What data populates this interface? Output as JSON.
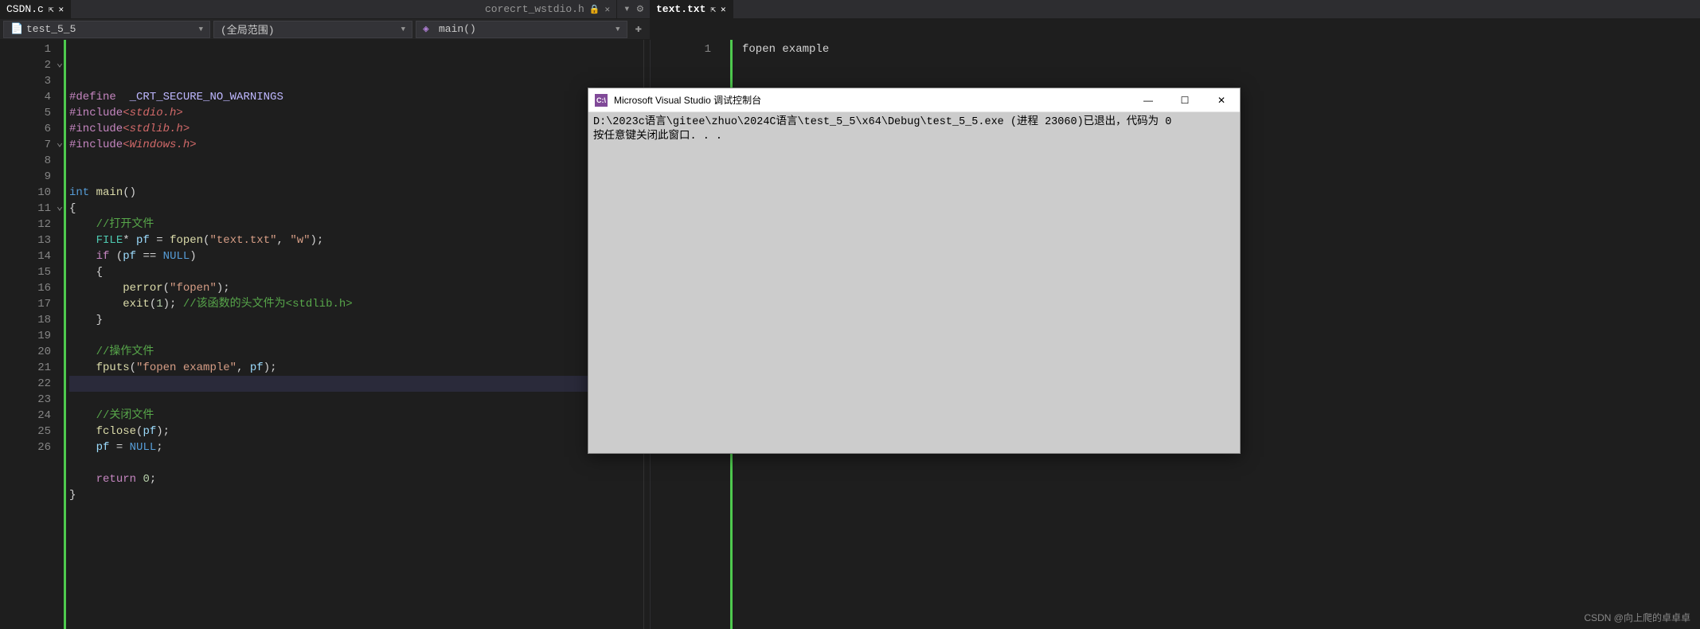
{
  "tabs": {
    "left_active": "CSDN.c",
    "center_inactive": "corecrt_wstdio.h",
    "right_active": "text.txt"
  },
  "context": {
    "file": "test_5_5",
    "scope": "(全局范围)",
    "function": "main()"
  },
  "left_code": {
    "lines": [
      {
        "n": 1,
        "html": "<span class='ppkw'>#define</span>  <span class='mac'>_CRT_SECURE_NO_WARNINGS</span>"
      },
      {
        "n": 2,
        "fold": "⌄",
        "html": "<span class='ppkw'>#include</span><span class='inc'>&lt;stdio.h&gt;</span>"
      },
      {
        "n": 3,
        "html": "<span class='ppkw'>#include</span><span class='inc'>&lt;stdlib.h&gt;</span>"
      },
      {
        "n": 4,
        "html": "<span class='ppkw'>#include</span><span class='inc'>&lt;Windows.h&gt;</span>"
      },
      {
        "n": 5,
        "html": ""
      },
      {
        "n": 6,
        "html": ""
      },
      {
        "n": 7,
        "fold": "⌄",
        "html": "<span class='kw'>int</span> <span class='fn'>main</span><span class='p'>()</span>"
      },
      {
        "n": 8,
        "html": "<span class='p'>{</span>"
      },
      {
        "n": 9,
        "html": "    <span class='cmt'>//打开文件</span>"
      },
      {
        "n": 10,
        "html": "    <span class='typ'>FILE</span><span class='p'>*</span> <span class='id'>pf</span> <span class='p'>=</span> <span class='fn'>fopen</span><span class='p'>(</span><span class='str'>\"text.txt\"</span><span class='p'>,</span> <span class='str'>\"w\"</span><span class='p'>);</span>"
      },
      {
        "n": 11,
        "fold": "⌄",
        "html": "    <span class='kw2'>if</span> <span class='p'>(</span><span class='id'>pf</span> <span class='p'>==</span> <span class='kw'>NULL</span><span class='p'>)</span>"
      },
      {
        "n": 12,
        "html": "    <span class='p'>{</span>"
      },
      {
        "n": 13,
        "html": "        <span class='fn'>perror</span><span class='p'>(</span><span class='str'>\"fopen\"</span><span class='p'>);</span>"
      },
      {
        "n": 14,
        "html": "        <span class='fn'>exit</span><span class='p'>(</span><span class='num'>1</span><span class='p'>);</span> <span class='cmt'>//该函数的头文件为&lt;stdlib.h&gt;</span>"
      },
      {
        "n": 15,
        "html": "    <span class='p'>}</span>"
      },
      {
        "n": 16,
        "html": ""
      },
      {
        "n": 17,
        "html": "    <span class='cmt'>//操作文件</span>"
      },
      {
        "n": 18,
        "html": "    <span class='fn'>fputs</span><span class='p'>(</span><span class='str'>\"fopen example\"</span><span class='p'>,</span> <span class='id'>pf</span><span class='p'>);</span>"
      },
      {
        "n": 19,
        "hl": true,
        "html": ""
      },
      {
        "n": 20,
        "html": ""
      },
      {
        "n": 21,
        "html": "    <span class='cmt'>//关闭文件</span>"
      },
      {
        "n": 22,
        "html": "    <span class='fn'>fclose</span><span class='p'>(</span><span class='id'>pf</span><span class='p'>);</span>"
      },
      {
        "n": 23,
        "html": "    <span class='id'>pf</span> <span class='p'>=</span> <span class='kw'>NULL</span><span class='p'>;</span>"
      },
      {
        "n": 24,
        "html": ""
      },
      {
        "n": 25,
        "html": "    <span class='kw2'>return</span> <span class='num'>0</span><span class='p'>;</span>"
      },
      {
        "n": 26,
        "html": "<span class='p'>}</span>"
      }
    ]
  },
  "right_code": {
    "line_number": "1",
    "content": "fopen example"
  },
  "console": {
    "title": "Microsoft Visual Studio 调试控制台",
    "icon_text": "C:\\",
    "body_line1": "D:\\2023c语言\\gitee\\zhuo\\2024C语言\\test_5_5\\x64\\Debug\\test_5_5.exe (进程 23060)已退出，代码为 0",
    "body_line2": "按任意键关闭此窗口. . ."
  },
  "watermark": "CSDN @向上爬的卓卓卓"
}
